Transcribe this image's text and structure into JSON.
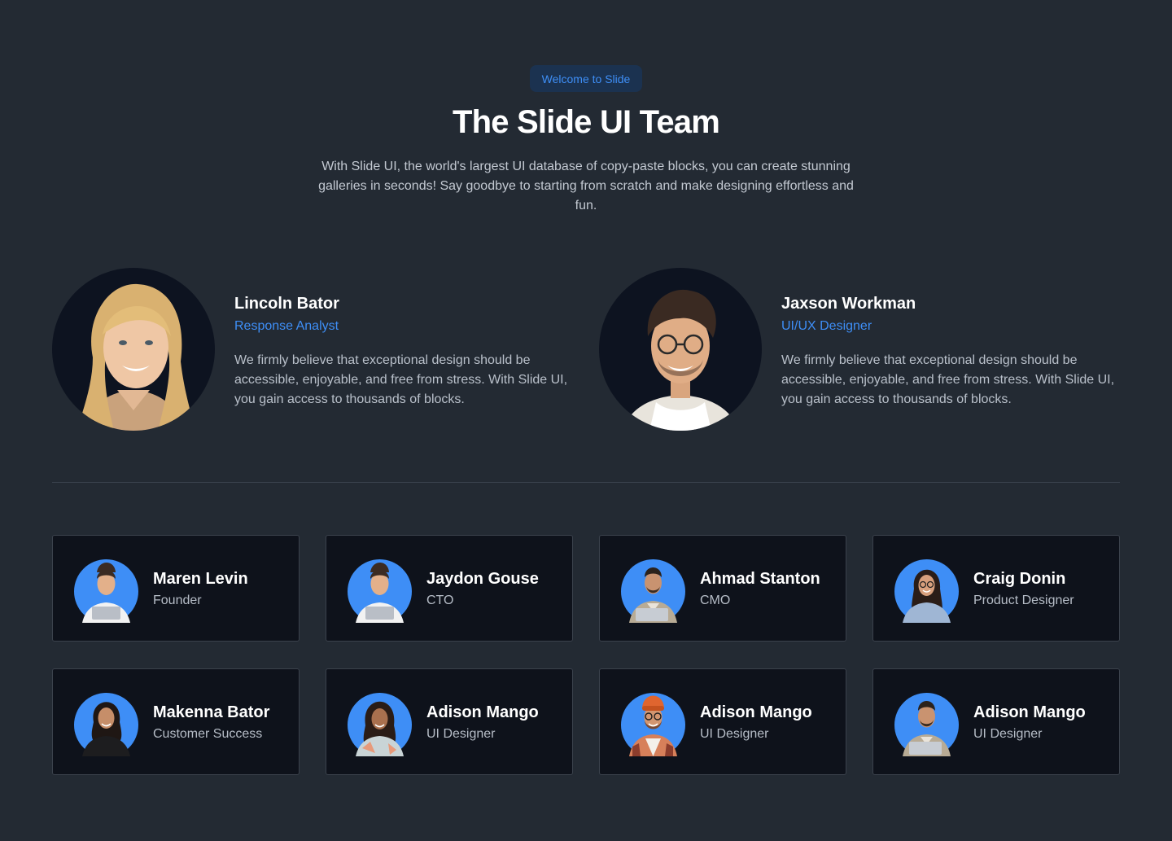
{
  "header": {
    "badge": "Welcome to Slide",
    "title": "The Slide UI Team",
    "description": "With Slide UI, the world's largest UI database of copy-paste blocks, you can create stunning galleries in seconds! Say goodbye to starting from scratch and make designing effortless and fun."
  },
  "featured": [
    {
      "name": "Lincoln Bator",
      "role": "Response Analyst",
      "bio": "We firmly believe that exceptional design should be accessible, enjoyable, and free from stress. With Slide UI, you gain access to thousands of blocks."
    },
    {
      "name": "Jaxson Workman",
      "role": "UI/UX Designer",
      "bio": "We firmly believe that exceptional design should be accessible, enjoyable, and free from stress. With Slide UI, you gain access to thousands of blocks."
    }
  ],
  "team": [
    {
      "name": "Maren Levin",
      "role": "Founder"
    },
    {
      "name": "Jaydon Gouse",
      "role": "CTO"
    },
    {
      "name": "Ahmad Stanton",
      "role": "CMO"
    },
    {
      "name": "Craig Donin",
      "role": "Product Designer"
    },
    {
      "name": "Makenna Bator",
      "role": "Customer Success"
    },
    {
      "name": "Adison Mango",
      "role": "UI Designer"
    },
    {
      "name": "Adison Mango",
      "role": "UI Designer"
    },
    {
      "name": "Adison Mango",
      "role": "UI Designer"
    }
  ],
  "colors": {
    "background": "#232a33",
    "accent": "#3e8ef6",
    "card": "#0e121b"
  }
}
